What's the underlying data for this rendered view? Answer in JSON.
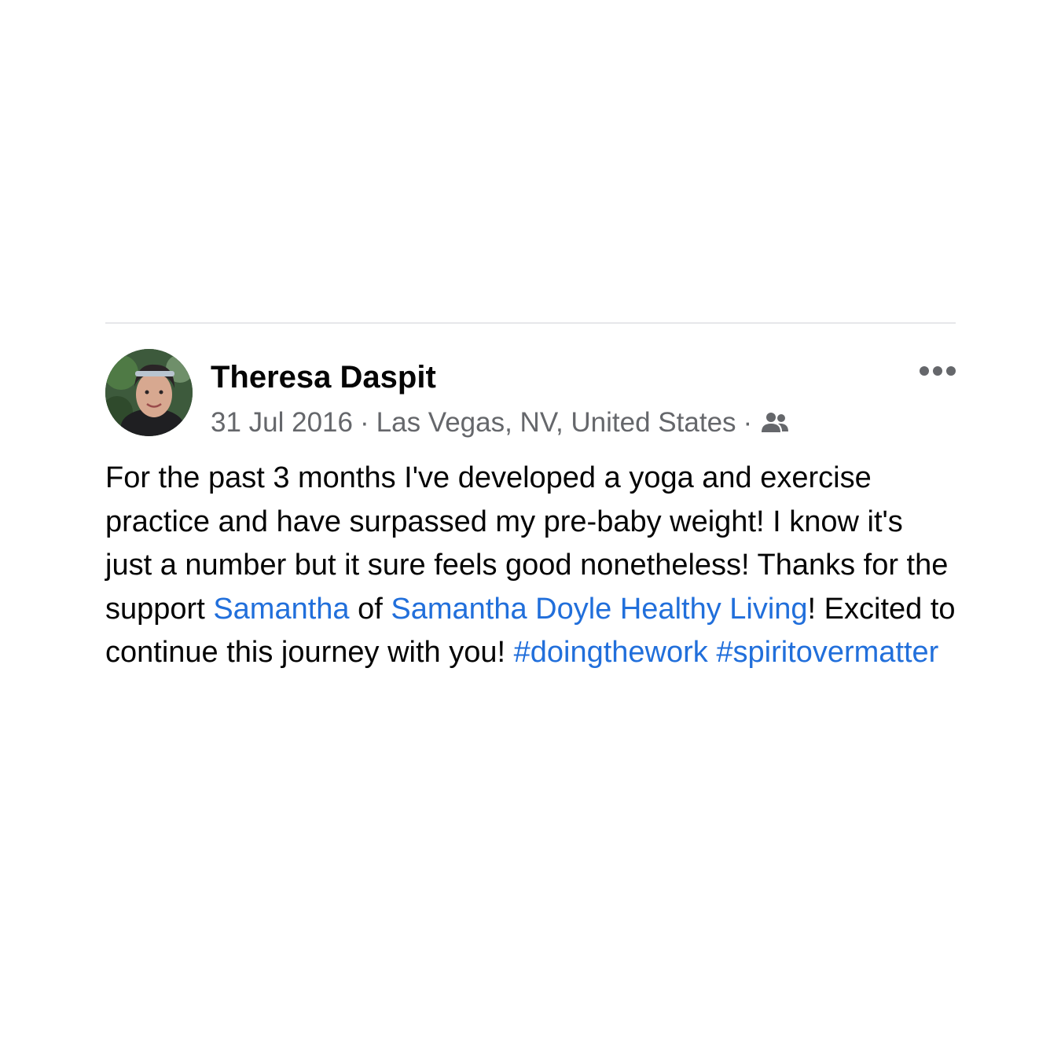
{
  "post": {
    "author_name": "Theresa Daspit",
    "date": "31 Jul 2016",
    "separator": "·",
    "location": "Las Vegas, NV, United States",
    "audience_icon": "friends-icon",
    "more_icon": "more-options-icon",
    "text": {
      "part1": "For the past 3 months I've developed a yoga and exercise practice and have surpassed my pre-baby weight! I know it's just a number but it sure feels good nonetheless! Thanks for the support ",
      "mention1": "Samantha",
      "part2": " of ",
      "mention2": "Samantha Doyle Healthy Living",
      "part3": "! Excited to continue this journey with you! ",
      "hashtag1": "#doingthework",
      "space": " ",
      "hashtag2": "#spiritovermatter"
    }
  },
  "colors": {
    "link": "#216fdb",
    "meta_text": "#65676b",
    "primary_text": "#050505",
    "divider": "#e6e7ea"
  }
}
